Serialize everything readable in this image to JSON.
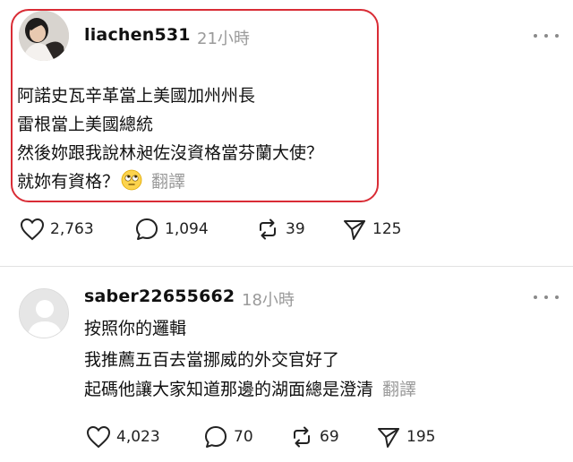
{
  "posts": [
    {
      "username": "liachen531",
      "timestamp": "21小時",
      "lines": [
        "阿諾史瓦辛革當上美國加州州長",
        "雷根當上美國總統",
        "然後妳跟我說林昶佐沒資格當芬蘭大使？",
        "就妳有資格？"
      ],
      "emoji": "rolling-eyes-emoji",
      "translate_label": "翻譯",
      "likes": "2,763",
      "replies": "1,094",
      "reposts": "39",
      "shares": "125",
      "highlight_color": "#d92c35"
    },
    {
      "username": "saber22655662",
      "timestamp": "18小時",
      "lines": [
        "按照你的邏輯",
        "我推薦五百去當挪威的外交官好了",
        "起碼他讓大家知道那邊的湖面總是澄清"
      ],
      "translate_label": "翻譯",
      "likes": "4,023",
      "replies": "70",
      "reposts": "69",
      "shares": "195"
    }
  ]
}
